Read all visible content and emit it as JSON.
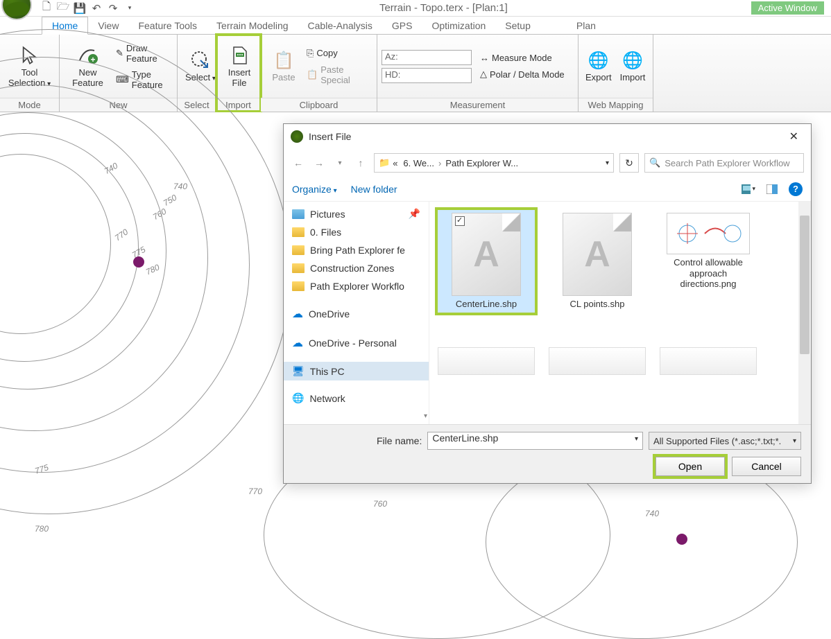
{
  "title": "Terrain - Topo.terx - [Plan:1]",
  "active_window": "Active Window",
  "tabs": [
    "Home",
    "View",
    "Feature Tools",
    "Terrain Modeling",
    "Cable-Analysis",
    "GPS",
    "Optimization",
    "Setup",
    "Plan"
  ],
  "active_tab": "Home",
  "ribbon": {
    "mode": {
      "tool_selection": "Tool Selection",
      "label": "Mode"
    },
    "new": {
      "new_feature": "New Feature",
      "draw_feature": "Draw Feature",
      "type_feature": "Type Feature",
      "label": "New"
    },
    "select": {
      "select": "Select",
      "label": "Select"
    },
    "import": {
      "insert_file": "Insert File",
      "label": "Import"
    },
    "clipboard": {
      "paste": "Paste",
      "copy": "Copy",
      "paste_special": "Paste Special",
      "label": "Clipboard"
    },
    "measurement": {
      "az": "Az:",
      "hd": "HD:",
      "measure_mode": "Measure Mode",
      "polar_mode": "Polar / Delta Mode",
      "label": "Measurement"
    },
    "web": {
      "export": "Export",
      "import": "Import",
      "label": "Web Mapping"
    }
  },
  "contours": [
    "740",
    "750",
    "760",
    "770",
    "775",
    "780",
    "775",
    "770",
    "760",
    "740",
    "780",
    "740"
  ],
  "dialog": {
    "title": "Insert File",
    "breadcrumb": {
      "prefix": "«",
      "seg1": "6. We...",
      "seg2": "Path Explorer W..."
    },
    "search_placeholder": "Search Path Explorer Workflow",
    "organize": "Organize",
    "new_folder": "New folder",
    "tree": [
      {
        "icon": "pic",
        "label": "Pictures",
        "pinned": true
      },
      {
        "icon": "folder",
        "label": "0. Files"
      },
      {
        "icon": "folder",
        "label": "Bring Path Explorer fe"
      },
      {
        "icon": "folder",
        "label": "Construction Zones"
      },
      {
        "icon": "folder",
        "label": "Path Explorer Workflo"
      },
      {
        "icon": "cloud",
        "label": "OneDrive",
        "gap": true
      },
      {
        "icon": "cloud",
        "label": "OneDrive - Personal",
        "gap": true
      },
      {
        "icon": "pc",
        "label": "This PC",
        "selected": true,
        "gap": true
      },
      {
        "icon": "net",
        "label": "Network",
        "gap": true
      }
    ],
    "files": [
      {
        "name": "CenterLine.shp",
        "type": "shp",
        "selected": true,
        "checked": true
      },
      {
        "name": "CL points.shp",
        "type": "shp"
      },
      {
        "name": "Control allowable approach directions.png",
        "type": "img"
      }
    ],
    "file_name_label": "File name:",
    "file_name_value": "CenterLine.shp",
    "filter": "All Supported Files (*.asc;*.txt;*.",
    "open": "Open",
    "cancel": "Cancel"
  }
}
